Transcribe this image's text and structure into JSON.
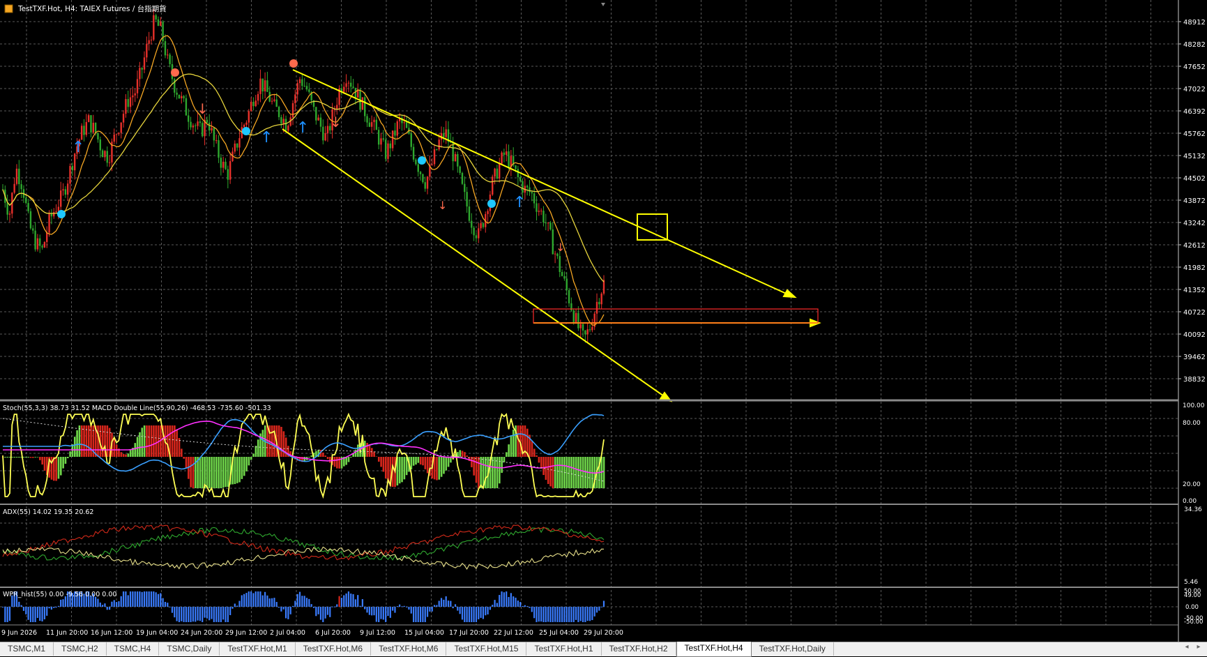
{
  "window": {
    "title": "TestTXF.Hot, H4:  TAIEX Futures / 台指期貨"
  },
  "colors": {
    "background": "#000000",
    "grid": "#5a5a5a",
    "bull_candle": "#e8302a",
    "bear_candle": "#2ea82e",
    "ma_fast": "#f5a623",
    "ma_slow": "#e6d43c",
    "trendline": "#ffff00",
    "signal_up": "#1e90ff",
    "signal_dot": "#1ec8ff",
    "signal_down": "#ff6a4d",
    "zone_rect": "#ff2a2a",
    "stoch_line": "#ffff55",
    "macd_signal": "#ff30ff",
    "macd_main": "#3aa0ff",
    "adx_main": "#e8e08a",
    "adx_plus": "#2fa82f",
    "adx_minus": "#d22a1a",
    "wpr_hist": "#3a7cff"
  },
  "price_axis": {
    "labels": [
      "48912",
      "48282",
      "47652",
      "47022",
      "46392",
      "45762",
      "45132",
      "44502",
      "43872",
      "43242",
      "42612",
      "41982",
      "41352",
      "40722",
      "40092",
      "39462",
      "38832"
    ]
  },
  "stoch_panel": {
    "label": "Stoch(55,3,3) 38.73 31.52 MACD Double Line(55,90,26) -468.53 -735.60 -501.33",
    "axis": [
      "100.00",
      "80.00",
      "20.00",
      "0.00"
    ]
  },
  "adx_panel": {
    "label": "ADX(55) 14.02 19.35 20.62",
    "axis": [
      "34.36",
      "5.46"
    ]
  },
  "wpr_panel": {
    "label": "WPR_hist(55) 0.00 -9.56 0.00 0.00",
    "axis": [
      "50.00",
      "49.00",
      "0.00",
      "-50.00",
      "-50.00"
    ]
  },
  "time_axis": {
    "labels": [
      "9 Jun 2026",
      "11 Jun 20:00",
      "16 Jun 12:00",
      "19 Jun 04:00",
      "24 Jun 20:00",
      "29 Jun 12:00",
      "2 Jul 04:00",
      "6 Jul 20:00",
      "9 Jul 12:00",
      "15 Jul 04:00",
      "17 Jul 20:00",
      "22 Jul 12:00",
      "25 Jul 04:00",
      "29 Jul 20:00"
    ]
  },
  "tabs": [
    {
      "label": "TSMC,M1",
      "active": false
    },
    {
      "label": "TSMC,H2",
      "active": false
    },
    {
      "label": "TSMC,H4",
      "active": false
    },
    {
      "label": "TSMC,Daily",
      "active": false
    },
    {
      "label": "TestTXF.Hot,M1",
      "active": false
    },
    {
      "label": "TestTXF.Hot,M6",
      "active": false
    },
    {
      "label": "TestTXF.Hot,M6",
      "active": false
    },
    {
      "label": "TestTXF.Hot,M15",
      "active": false
    },
    {
      "label": "TestTXF.Hot,H1",
      "active": false
    },
    {
      "label": "TestTXF.Hot,H2",
      "active": false
    },
    {
      "label": "TestTXF.Hot,H4",
      "active": true
    },
    {
      "label": "TestTXF.Hot,Daily",
      "active": false
    }
  ],
  "chart_data": {
    "type": "candlestick",
    "title": "TestTXF.Hot, H4:  TAIEX Futures / 台指期貨",
    "ylim": [
      38600,
      49200
    ],
    "close_path": [
      44200,
      43500,
      44800,
      44300,
      43200,
      42700,
      42500,
      43300,
      43700,
      44000,
      44600,
      45300,
      45800,
      46100,
      45800,
      45300,
      45100,
      45700,
      46200,
      46700,
      46900,
      47500,
      48300,
      48900,
      48600,
      47700,
      47100,
      46700,
      46300,
      46000,
      45800,
      46200,
      45500,
      45000,
      44600,
      45200,
      45800,
      46200,
      46800,
      47200,
      46900,
      46500,
      46300,
      46000,
      46700,
      47300,
      47000,
      46400,
      46000,
      45600,
      46300,
      47000,
      47400,
      47100,
      46700,
      46300,
      46000,
      45600,
      45200,
      45600,
      46100,
      45900,
      45300,
      44800,
      44400,
      44900,
      45500,
      45800,
      45300,
      44600,
      43900,
      43300,
      42900,
      43500,
      44300,
      44800,
      45200,
      44900,
      44500,
      44200,
      44100,
      43700,
      43400,
      42800,
      42200,
      41600,
      41000,
      40400,
      40000,
      40400,
      41100,
      41600
    ]
  }
}
